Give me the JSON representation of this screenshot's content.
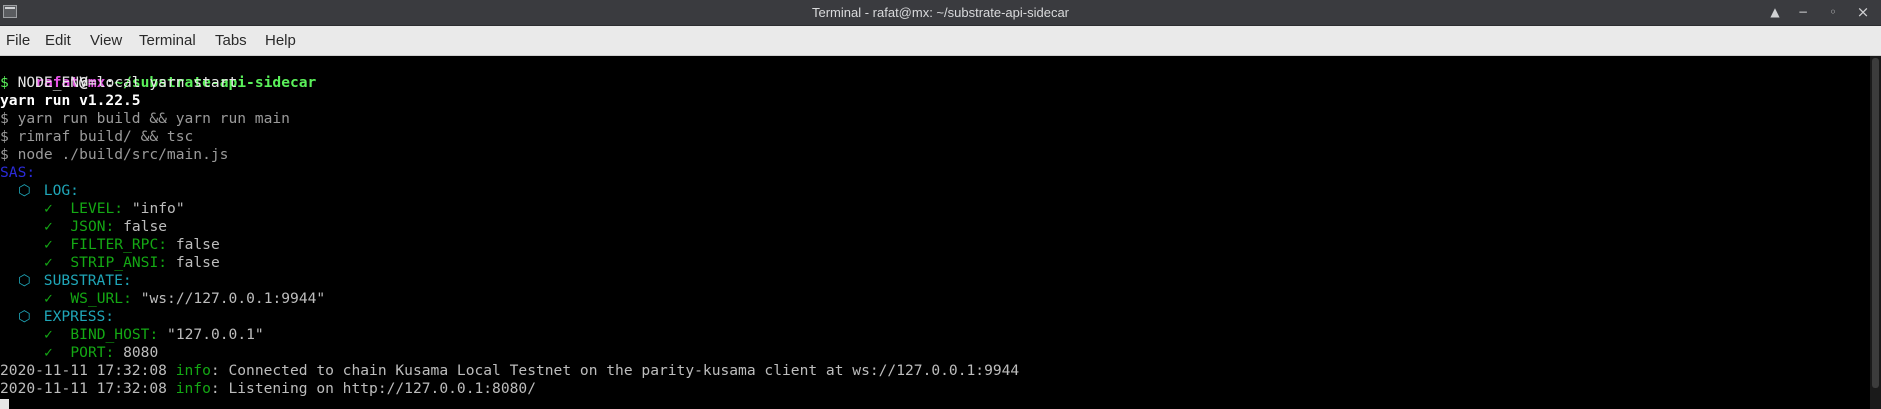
{
  "window": {
    "title": "Terminal - rafat@mx: ~/substrate-api-sidecar",
    "buttons": {
      "keep_above": "▲",
      "minimize": "−",
      "maximize": "◦",
      "close": "×"
    }
  },
  "menu": [
    "File",
    "Edit",
    "View",
    "Terminal",
    "Tabs",
    "Help"
  ],
  "terminal": {
    "prompt": {
      "user": "rafat",
      "at": "@",
      "host": "mx",
      "colon": ":",
      "path": "~/substrate-api-sidecar"
    },
    "lines": [
      {
        "prefix": "$ ",
        "text": "NODE_ENV=local yarn start"
      },
      {
        "text": "yarn run v1.22.5"
      },
      {
        "text": "$ yarn run build && yarn run main"
      },
      {
        "text": "$ rimraf build/ && tsc"
      },
      {
        "text": "$ node ./build/src/main.js"
      },
      {
        "text": "SAS:"
      }
    ],
    "config": [
      {
        "group": "LOG:",
        "items": [
          {
            "key": "LEVEL:",
            "value": "\"info\""
          },
          {
            "key": "JSON:",
            "value": "false"
          },
          {
            "key": "FILTER_RPC:",
            "value": "false"
          },
          {
            "key": "STRIP_ANSI:",
            "value": "false"
          }
        ]
      },
      {
        "group": "SUBSTRATE:",
        "items": [
          {
            "key": "WS_URL:",
            "value": "\"ws://127.0.0.1:9944\""
          }
        ]
      },
      {
        "group": "EXPRESS:",
        "items": [
          {
            "key": "BIND_HOST:",
            "value": "\"127.0.0.1\""
          },
          {
            "key": "PORT:",
            "value": "8080"
          }
        ]
      }
    ],
    "logs": [
      {
        "ts": "2020-11-11 17:32:08",
        "level": "info",
        "msg": ": Connected to chain Kusama Local Testnet on the parity-kusama client at ws://127.0.0.1:9944"
      },
      {
        "ts": "2020-11-11 17:32:08",
        "level": "info",
        "msg": ": Listening on http://127.0.0.1:8080/"
      }
    ],
    "check_glyph": "✓",
    "cube_glyph": "⬡"
  },
  "colors": {
    "prompt_user": "#e454e4",
    "prompt_path": "#5af05a",
    "info": "#14a814",
    "group": "#1fa6b8",
    "sas": "#2b2bd8"
  }
}
